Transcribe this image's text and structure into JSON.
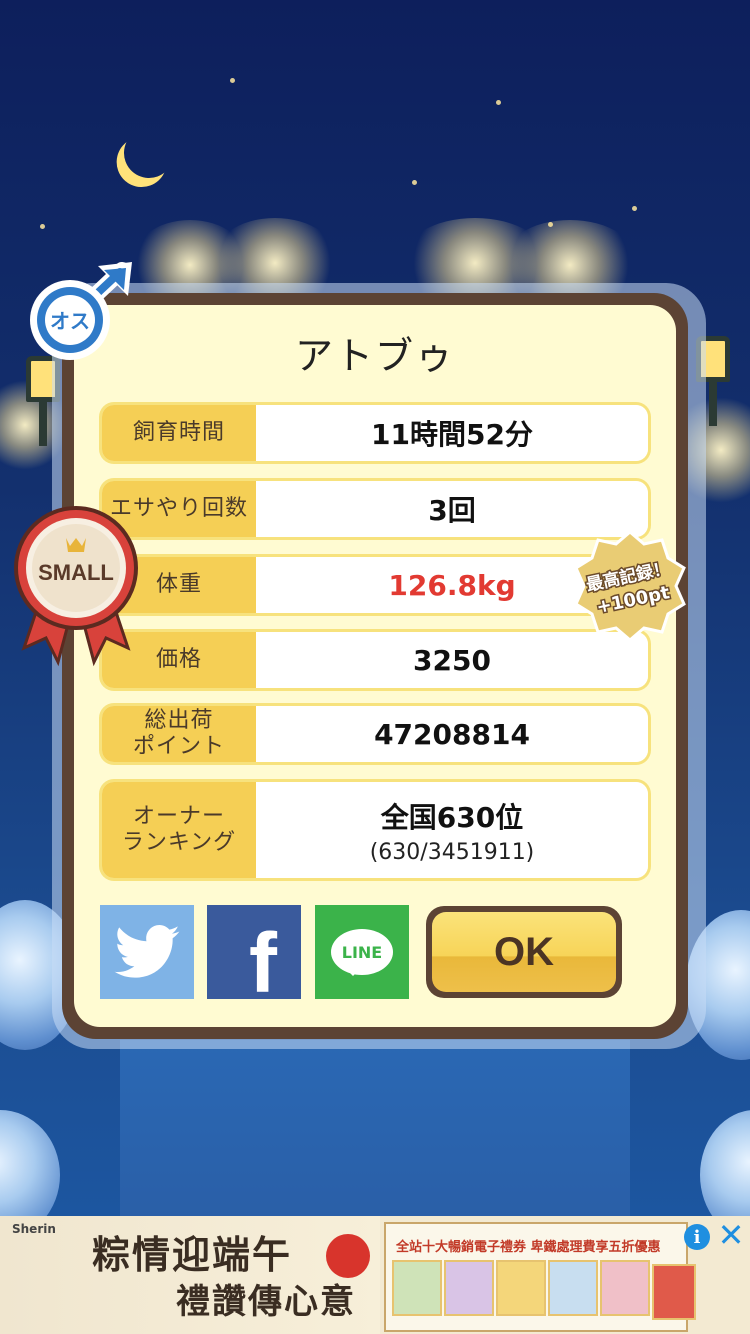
{
  "pet": {
    "name": "アトブゥ",
    "gender_label": "オス",
    "size_label": "SMALL"
  },
  "stats": [
    {
      "label": "飼育時間",
      "value": "11時間52分"
    },
    {
      "label": "エサやり回数",
      "value": "3回"
    },
    {
      "label": "体重",
      "value": "126.8kg"
    },
    {
      "label": "価格",
      "value": "3250"
    },
    {
      "label": "総出荷\nポイント",
      "value": "47208814"
    },
    {
      "label": "オーナー\nランキング",
      "value": "全国630位",
      "sub": "(630/3451911)"
    }
  ],
  "record_badge": {
    "line1": "最高記録！",
    "line2": "+100pt"
  },
  "share": {
    "facebook": "f",
    "line": "LINE"
  },
  "ok_label": "OK",
  "ad": {
    "brand": "Sherin",
    "headline_1": "粽情迎端午",
    "headline_2": "禮讚傳心意",
    "promo": "全站十大暢銷電子禮券 卑鐵處理費享五折優惠",
    "info": "i",
    "close": "✕"
  },
  "colors": {
    "label_bg": "#f5cf55",
    "highlight_value": "#e23a32",
    "dialog_border": "#5c4334",
    "dialog_bg": "#fffbd2",
    "twitter": "#7fb3e6",
    "facebook": "#3a5a9c",
    "line": "#3bb34a"
  }
}
